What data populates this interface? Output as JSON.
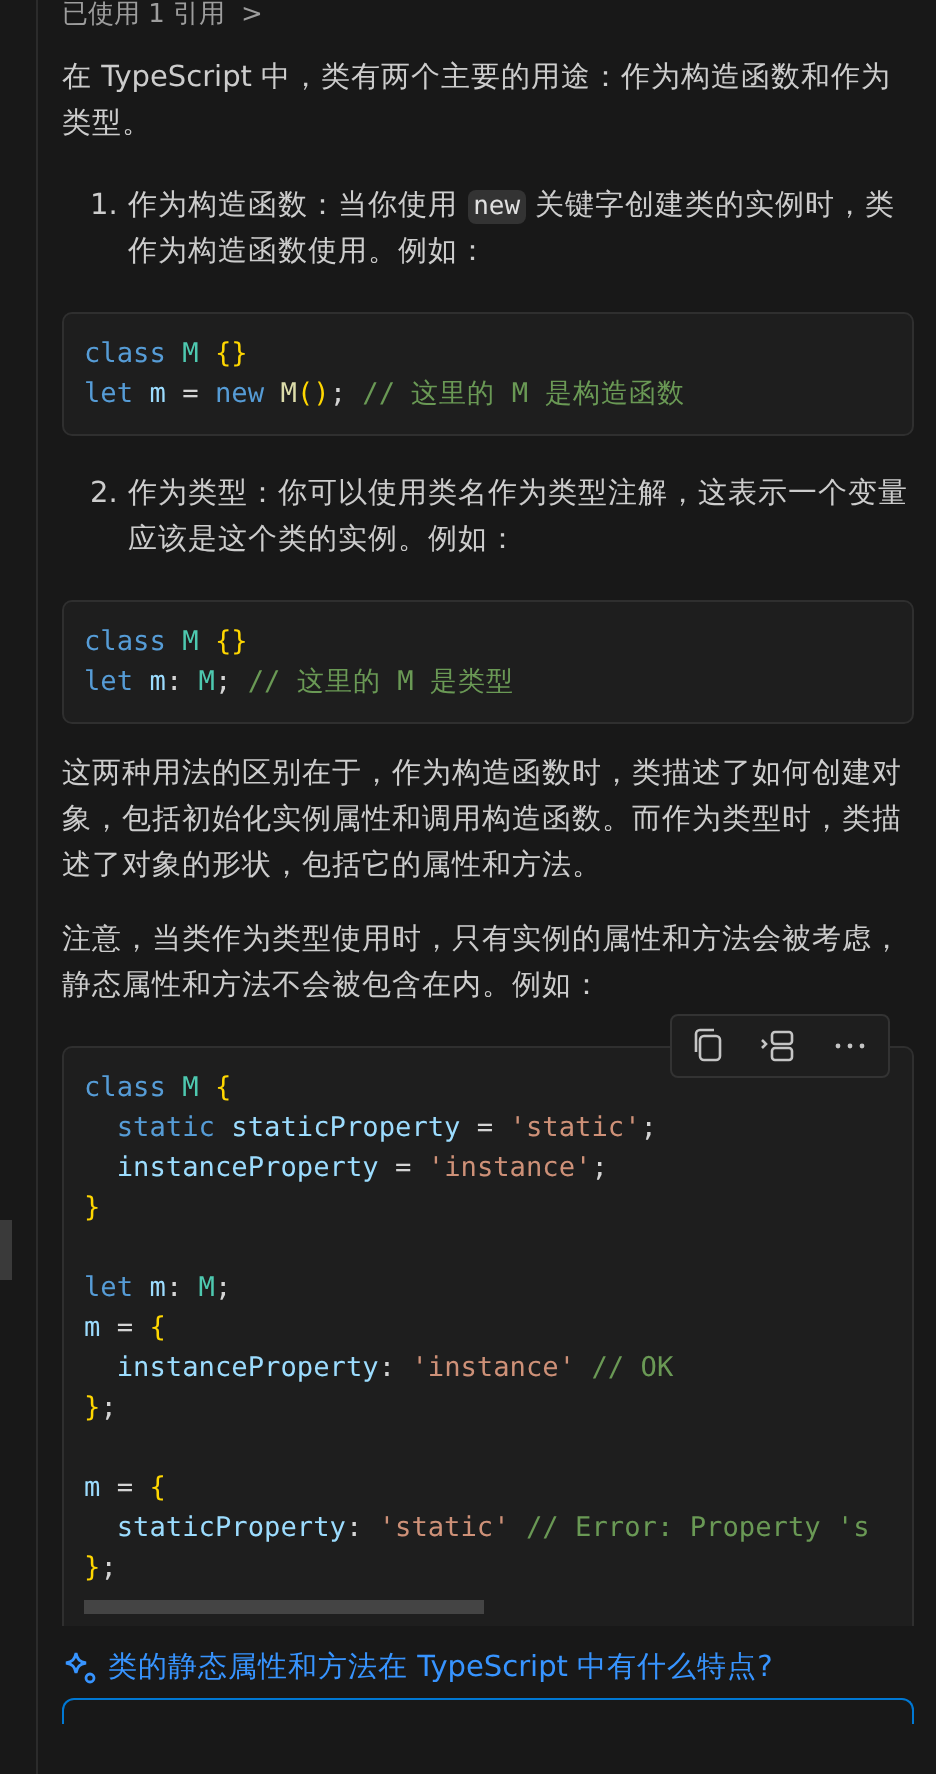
{
  "references": {
    "label": "已使用 1 引用",
    "chevron": ">"
  },
  "blocks": [
    {
      "kind": "paragraph",
      "parts": [
        {
          "kind": "text",
          "text": "在 TypeScript 中，类有两个主要的用途：作为构造函数和作为类型。"
        }
      ]
    },
    {
      "kind": "list_item",
      "number": "1.",
      "parts": [
        {
          "kind": "text",
          "text": "作为构造函数：当你使用 "
        },
        {
          "kind": "code",
          "text": "new"
        },
        {
          "kind": "text",
          "text": " 关键字创建类的实例时，类作为构造函数使用。例如："
        }
      ]
    },
    {
      "kind": "code_block",
      "lines": [
        {
          "kind": "code",
          "tokens": [
            {
              "kind": "keyword",
              "text": "class"
            },
            {
              "kind": "type",
              "text": " M"
            },
            {
              "kind": "brace",
              "text": " {}"
            }
          ]
        },
        {
          "kind": "code",
          "tokens": [
            {
              "kind": "keyword",
              "text": "let"
            },
            {
              "kind": "var",
              "text": " m"
            },
            {
              "kind": "plain",
              "text": " ="
            },
            {
              "kind": "keyword",
              "text": " new"
            },
            {
              "kind": "func",
              "text": " M"
            },
            {
              "kind": "brace",
              "text": "()"
            },
            {
              "kind": "plain",
              "text": ";"
            },
            {
              "kind": "comment",
              "text": " // 这里的 M 是构造函数"
            }
          ]
        }
      ]
    },
    {
      "kind": "list_item",
      "number": "2.",
      "parts": [
        {
          "kind": "text",
          "text": "作为类型：你可以使用类名作为类型注解，这表示一个变量应该是这个类的实例。例如："
        }
      ]
    },
    {
      "kind": "code_block",
      "lines": [
        {
          "kind": "code",
          "tokens": [
            {
              "kind": "keyword",
              "text": "class"
            },
            {
              "kind": "type",
              "text": " M"
            },
            {
              "kind": "brace",
              "text": " {}"
            }
          ]
        },
        {
          "kind": "code",
          "tokens": [
            {
              "kind": "keyword",
              "text": "let"
            },
            {
              "kind": "var",
              "text": " m"
            },
            {
              "kind": "plain",
              "text": ":"
            },
            {
              "kind": "type",
              "text": " M"
            },
            {
              "kind": "plain",
              "text": ";"
            },
            {
              "kind": "comment",
              "text": " // 这里的 M 是类型"
            }
          ]
        }
      ]
    },
    {
      "kind": "paragraph",
      "parts": [
        {
          "kind": "text",
          "text": "这两种用法的区别在于，作为构造函数时，类描述了如何创建对象，包括初始化实例属性和调用构造函数。而作为类型时，类描述了对象的形状，包括它的属性和方法。"
        }
      ]
    },
    {
      "kind": "paragraph",
      "parts": [
        {
          "kind": "text",
          "text": "注意，当类作为类型使用时，只有实例的属性和方法会被考虑，静态属性和方法不会被包含在内。例如："
        }
      ]
    },
    {
      "kind": "code_block",
      "toolbar": true,
      "cut": true,
      "lines": [
        {
          "kind": "code",
          "tokens": [
            {
              "kind": "keyword",
              "text": "class"
            },
            {
              "kind": "type",
              "text": " M"
            },
            {
              "kind": "brace",
              "text": " {"
            }
          ]
        },
        {
          "kind": "code",
          "tokens": [
            {
              "kind": "keyword",
              "text": "  static"
            },
            {
              "kind": "var",
              "text": " staticProperty"
            },
            {
              "kind": "plain",
              "text": " ="
            },
            {
              "kind": "string",
              "text": " 'static'"
            },
            {
              "kind": "plain",
              "text": ";"
            }
          ]
        },
        {
          "kind": "code",
          "tokens": [
            {
              "kind": "var",
              "text": "  instanceProperty"
            },
            {
              "kind": "plain",
              "text": " ="
            },
            {
              "kind": "string",
              "text": " 'instance'"
            },
            {
              "kind": "plain",
              "text": ";"
            }
          ]
        },
        {
          "kind": "code",
          "tokens": [
            {
              "kind": "brace",
              "text": "}"
            }
          ]
        },
        {
          "kind": "blank"
        },
        {
          "kind": "code",
          "tokens": [
            {
              "kind": "keyword",
              "text": "let"
            },
            {
              "kind": "var",
              "text": " m"
            },
            {
              "kind": "plain",
              "text": ":"
            },
            {
              "kind": "type",
              "text": " M"
            },
            {
              "kind": "plain",
              "text": ";"
            }
          ]
        },
        {
          "kind": "code",
          "tokens": [
            {
              "kind": "var",
              "text": "m"
            },
            {
              "kind": "plain",
              "text": " ="
            },
            {
              "kind": "brace",
              "text": " {"
            }
          ]
        },
        {
          "kind": "code",
          "tokens": [
            {
              "kind": "var",
              "text": "  instanceProperty"
            },
            {
              "kind": "plain",
              "text": ":"
            },
            {
              "kind": "string",
              "text": " 'instance'"
            },
            {
              "kind": "comment",
              "text": " // OK"
            }
          ]
        },
        {
          "kind": "code",
          "tokens": [
            {
              "kind": "brace",
              "text": "}"
            },
            {
              "kind": "plain",
              "text": ";"
            }
          ]
        },
        {
          "kind": "blank"
        },
        {
          "kind": "code",
          "tokens": [
            {
              "kind": "var",
              "text": "m"
            },
            {
              "kind": "plain",
              "text": " ="
            },
            {
              "kind": "brace",
              "text": " {"
            }
          ]
        },
        {
          "kind": "code",
          "tokens": [
            {
              "kind": "var",
              "text": "  staticProperty"
            },
            {
              "kind": "plain",
              "text": ":"
            },
            {
              "kind": "string",
              "text": " 'static'"
            },
            {
              "kind": "comment",
              "text": " // Error: Property 's"
            }
          ]
        },
        {
          "kind": "code",
          "tokens": [
            {
              "kind": "brace",
              "text": "}"
            },
            {
              "kind": "plain",
              "text": ";"
            }
          ]
        }
      ]
    }
  ],
  "followup": {
    "text": "类的静态属性和方法在 TypeScript 中有什么特点?"
  }
}
